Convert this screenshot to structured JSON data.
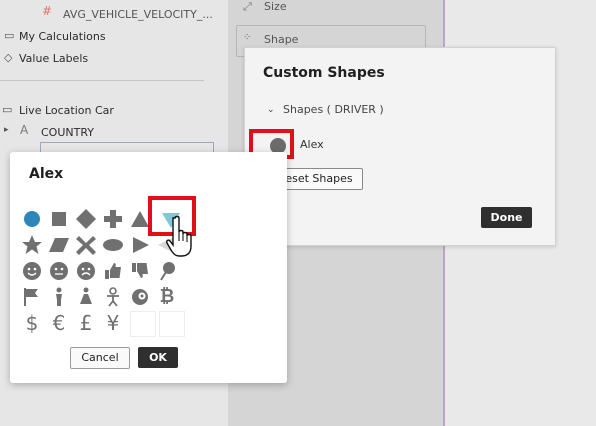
{
  "sidebar": {
    "field_name": "AVG_VEHICLE_VELOCITY_...",
    "my_calculations": "My Calculations",
    "value_labels": "Value Labels",
    "data_source": "Live Location Car",
    "country": "COUNTRY"
  },
  "middle": {
    "size_label": "Size",
    "shape_label": "Shape"
  },
  "custom_shapes": {
    "title": "Custom Shapes",
    "section": "Shapes ( DRIVER )",
    "row_label": "Alex",
    "reset_label": "eset Shapes",
    "done_label": "Done"
  },
  "picker": {
    "title": "Alex",
    "cancel_label": "Cancel",
    "ok_label": "OK",
    "shapes": [
      [
        "circle",
        "square",
        "diamond",
        "plus",
        "triangle-up",
        "triangle-down"
      ],
      [
        "star",
        "parallelogram",
        "x",
        "ellipse",
        "triangle-right",
        "triangle-left"
      ],
      [
        "smiley",
        "neutral-face",
        "sad-face",
        "thumbs-up",
        "thumbs-down",
        "pin"
      ],
      [
        "flag",
        "person",
        "person-dress",
        "baby",
        "target-badge",
        "bitcoin"
      ],
      [
        "dollar",
        "euro",
        "pound",
        "yen",
        "blank",
        "blank"
      ]
    ],
    "selected": "triangle-down",
    "colors": {
      "circle": "#2e86b8",
      "selected": "#7fc7d9",
      "default": "#707070"
    }
  },
  "colors": {
    "highlight": "#e0101a",
    "dark_button": "#2f2f2f"
  }
}
